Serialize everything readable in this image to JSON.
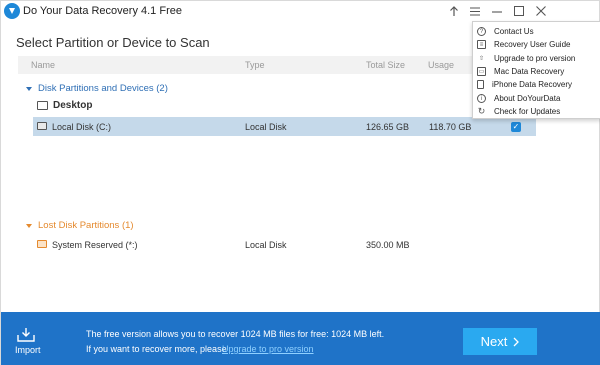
{
  "window": {
    "title": "Do Your Data Recovery 4.1 Free"
  },
  "heading": "Select Partition or Device to Scan",
  "columns": {
    "name": "Name",
    "type": "Type",
    "total_size": "Total Size",
    "usage": "Usage"
  },
  "groups": {
    "disk": {
      "title": "Disk Partitions and Devices (2)",
      "subgroup": "Desktop",
      "rows": [
        {
          "name": "Local Disk (C:)",
          "type": "Local Disk",
          "total": "126.65 GB",
          "used": "118.70 GB"
        }
      ]
    },
    "lost": {
      "title": "Lost Disk Partitions (1)",
      "rows": [
        {
          "name": "System Reserved (*:)",
          "type": "Local Disk",
          "total": "350.00 MB"
        }
      ]
    }
  },
  "menu": {
    "items": [
      {
        "label": "Contact Us",
        "icon": "question-icon"
      },
      {
        "label": "Recovery User Guide",
        "icon": "guide-icon"
      },
      {
        "label": "Upgrade to pro version",
        "icon": "upgrade-icon"
      },
      {
        "label": "Mac Data Recovery",
        "icon": "mac-icon"
      },
      {
        "label": "iPhone Data Recovery",
        "icon": "iphone-icon"
      },
      {
        "label": "About DoYourData",
        "icon": "info-icon"
      },
      {
        "label": "Check for Updates",
        "icon": "refresh-icon"
      }
    ]
  },
  "footer": {
    "import_label": "Import",
    "line1": "The free version allows you to recover 1024 MB files for free: 1024 MB left.",
    "line2": "If you want to recover more, please",
    "link": "Upgrade to pro version",
    "next_label": "Next"
  },
  "colors": {
    "accent": "#1f73c8",
    "next": "#2aa9f0",
    "selected_row": "#c5d9ea",
    "lost_group": "#e58a2e"
  }
}
